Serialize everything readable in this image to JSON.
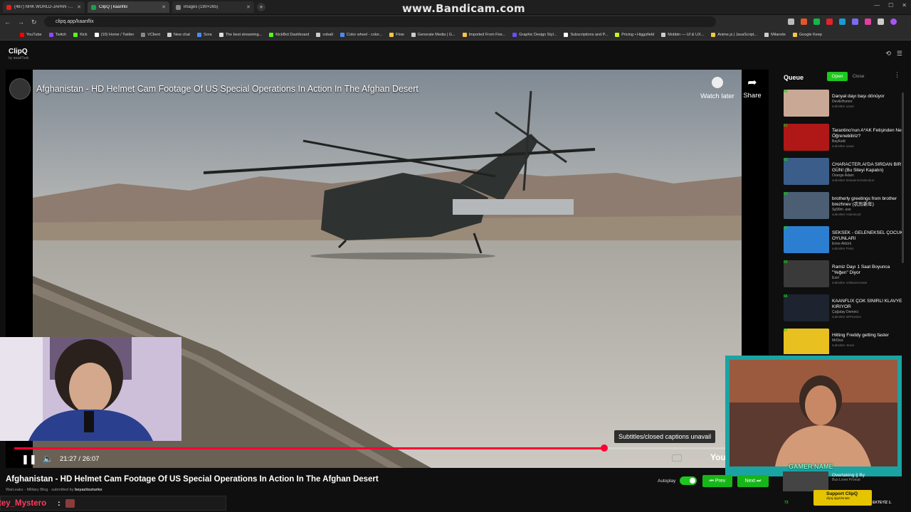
{
  "browser": {
    "tabs": [
      {
        "title": "(487) NHK WORLD-JAPAN - Yo",
        "active": false,
        "color": "#e02020"
      },
      {
        "title": "ClipQ | kaanflix",
        "active": true,
        "color": "#16a34a"
      },
      {
        "title": "images (190×265)",
        "active": false,
        "color": "#888888"
      }
    ],
    "new_tab": "+",
    "recording_watermark": "www.Bandicam.com",
    "url": "clipq.app/kaanflix",
    "bookmarks": [
      {
        "label": "YouTube",
        "color": "#ff0000"
      },
      {
        "label": "Twitch",
        "color": "#9146ff"
      },
      {
        "label": "Kick",
        "color": "#53fc18"
      },
      {
        "label": "(10) Home / Twitter",
        "color": "#ffffff"
      },
      {
        "label": "VClient",
        "color": "#888888"
      },
      {
        "label": "New chat",
        "color": "#cccccc"
      },
      {
        "label": "Sora",
        "color": "#4c8bf5"
      },
      {
        "label": "The best streaming...",
        "color": "#dddddd"
      },
      {
        "label": "KickBot Dashboard",
        "color": "#53fc18"
      },
      {
        "label": "cobalt",
        "color": "#cccccc"
      },
      {
        "label": "Color wheel - color...",
        "color": "#4c8bf5"
      },
      {
        "label": "Flow",
        "color": "#f5c542"
      },
      {
        "label": "Generate Media | G...",
        "color": "#cccccc"
      },
      {
        "label": "Imported From Fire...",
        "color": "#f5c542"
      },
      {
        "label": "Graphic Design Styl...",
        "color": "#6c4cf5"
      },
      {
        "label": "Subscriptions and P...",
        "color": "#ffffff"
      },
      {
        "label": "Pricing • Higgsfield",
        "color": "#c6f51a"
      },
      {
        "label": "Mobbin — UI & UX...",
        "color": "#cccccc"
      },
      {
        "label": "Anime.js | JavaScript...",
        "color": "#f5c542"
      },
      {
        "label": "Milanote",
        "color": "#cccccc"
      },
      {
        "label": "Google Keep",
        "color": "#f5c542"
      }
    ]
  },
  "app": {
    "name": "ClipQ",
    "byline": "by awaitTask"
  },
  "player": {
    "title": "Afghanistan - HD Helmet Cam Footage Of US Special Operations In Action In The Afghan Desert",
    "watch_later": "Watch later",
    "share": "Share",
    "subtitles_message": "Subtitles/closed captions unavail",
    "time": "21:27 / 26:07",
    "progress_fraction": 0.821,
    "youtube_label": "YouT"
  },
  "video_meta": {
    "title": "Afghanistan - HD Helmet Cam Footage Of US Special Operations In Action In The Afghan Desert",
    "channel": "WarLeaks - Military Blog",
    "submitted_prefix": "· submitted by",
    "submitter": "beyazitozturko"
  },
  "controls": {
    "autoplay": "Autoplay",
    "prev": "⏮ Prev",
    "next": "Next ⏭"
  },
  "queue": {
    "title": "Queue",
    "open": "Open",
    "close": "Close",
    "items": [
      {
        "num": "60",
        "title": "Danyal dayı başı dönüyor",
        "channel": "DevilsHumor",
        "submitter": "submitter uasar",
        "thumb": "#caa896"
      },
      {
        "num": "61",
        "title": "Tarantino'nun A*AK Fetişinden Ne Öğrenebiliriz?",
        "channel": "BayKedi",
        "submitter": "submitter uasar",
        "thumb": "#b01818"
      },
      {
        "num": "62",
        "title": "CHARACTER.AI'DA SIRDAN BİR GÜN! (Bu Siteyi Kapatın)",
        "channel": "Orange Adam",
        "submitter": "submitter beluaenremidovdurr",
        "thumb": "#3b5d8a"
      },
      {
        "num": "63",
        "title": "brotherly greetings from brother brezhnev (农历新年)",
        "channel": "Sp99m .exe",
        "submitter": "submitter AsbestosZ",
        "thumb": "#4b5e74"
      },
      {
        "num": "64",
        "title": "SEKSEK - GELENEKSEL ÇOCUK OYUNLARI",
        "channel": "Emre Aktürk",
        "submitter": "submitter Pviss",
        "thumb": "#2c7fd0"
      },
      {
        "num": "65",
        "title": "Ramiz Dayı 1 Saat Boyunca \"Yeğen\" Diyor",
        "channel": "Ezel",
        "submitter": "submitter softwarecreate",
        "thumb": "#3a3a3a"
      },
      {
        "num": "66",
        "title": "KAANFLİX ÇOK SİNİRLİ KLAVYE KIRIYOR",
        "channel": "Çağatay Demirci",
        "submitter": "submitter MrPassion",
        "thumb": "#1d2430"
      },
      {
        "num": "67",
        "title": "Hitting Freddy getting faster",
        "channel": "MrDice",
        "submitter": "submitter Jewis",
        "thumb": "#e8c020"
      }
    ]
  },
  "overlays": {
    "gamer_name": "GAMER NAME",
    "chat_user": "tey_Mystero",
    "chat_colon": ":",
    "next_queue_title": "Overtaking || By",
    "next_queue_channel": "Bus Lover Pronuit",
    "next_queue_num": "73",
    "support_title": "Support ClipQ",
    "support_sub": "clipq.app/donate",
    "tail_text": "EKTEYİZ 1."
  }
}
